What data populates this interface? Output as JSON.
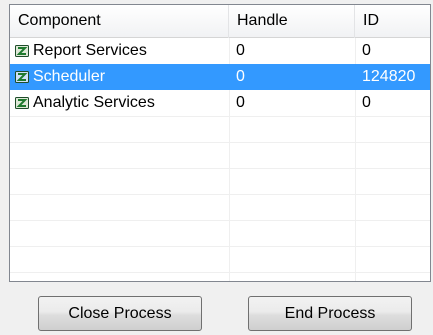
{
  "table": {
    "columns": [
      "Component",
      "Handle",
      "ID"
    ],
    "rows": [
      {
        "name": "Report Services",
        "handle": "0",
        "id": "0",
        "icon": "component-icon",
        "selected": false
      },
      {
        "name": "Scheduler",
        "handle": "0",
        "id": "124820",
        "icon": "component-icon",
        "selected": true
      },
      {
        "name": "Analytic Services",
        "handle": "0",
        "id": "0",
        "icon": "component-icon",
        "selected": false
      }
    ]
  },
  "buttons": {
    "close_label": "Close Process",
    "end_label": "End Process"
  },
  "colors": {
    "selection": "#3399ff",
    "icon_green": "#1f7a2e"
  }
}
